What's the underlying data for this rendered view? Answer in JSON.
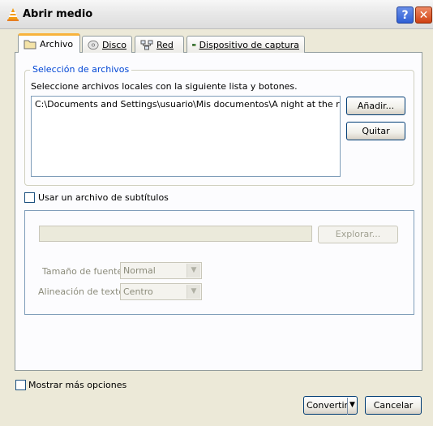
{
  "window": {
    "title": "Abrir medio",
    "help_label": "?",
    "close_label": "✕"
  },
  "tabs": [
    {
      "label": "Archivo",
      "icon": "folder-icon"
    },
    {
      "label": "Disco",
      "icon": "disc-icon"
    },
    {
      "label": "Red",
      "icon": "network-icon"
    },
    {
      "label": "Dispositivo de captura",
      "icon": "capture-card-icon"
    }
  ],
  "file_selection": {
    "legend": "Selección de archivos",
    "description": "Seleccione archivos locales con la siguiente lista y botones.",
    "files": [
      "C:\\Documents and Settings\\usuario\\Mis documentos\\A night at the roxbury..."
    ],
    "add_label": "Añadir...",
    "remove_label": "Quitar"
  },
  "subtitles": {
    "checkbox_label": "Usar un archivo de subtítulos",
    "checked": false,
    "browse_label": "Explorar...",
    "font_size_label": "Tamaño de fuente:",
    "font_size_value": "Normal",
    "alignment_label": "Alineación de texto:",
    "alignment_value": "Centro"
  },
  "footer": {
    "more_options_label": "Mostrar más opciones",
    "more_options_checked": false,
    "convert_label": "Convertir",
    "cancel_label": "Cancelar"
  },
  "colors": {
    "accent_tab": "#f8b33b",
    "legend_text": "#0046d5",
    "close_button": "#d04012"
  }
}
